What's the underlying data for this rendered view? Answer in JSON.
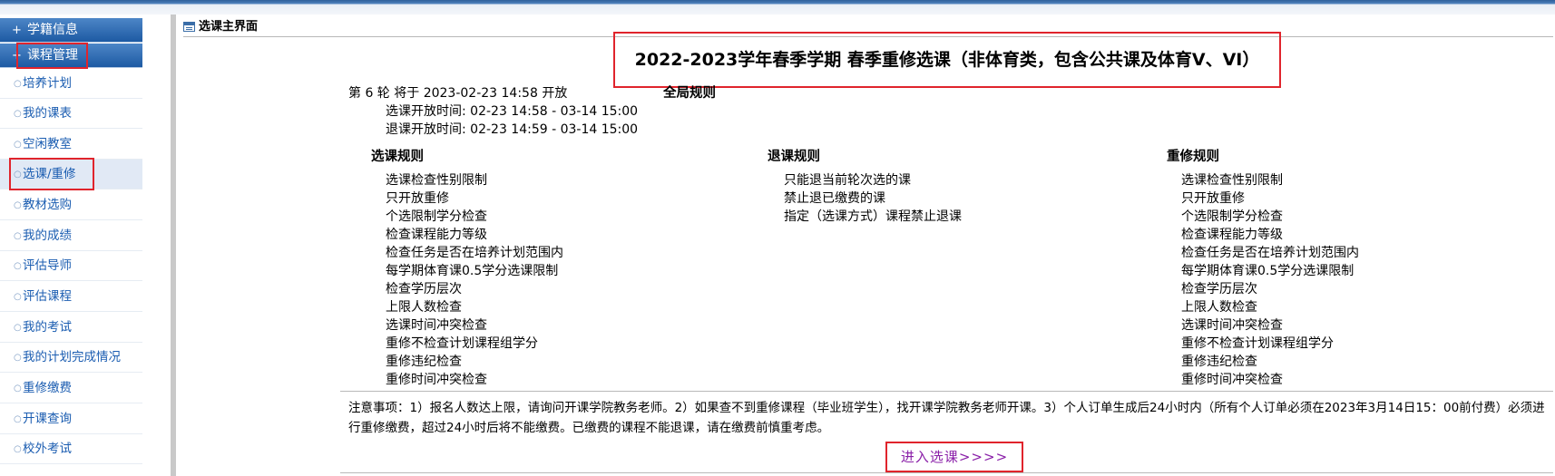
{
  "sidebar": {
    "sections": [
      {
        "label": "学籍信息"
      },
      {
        "label": "课程管理"
      }
    ],
    "items": [
      {
        "label": "培养计划"
      },
      {
        "label": "我的课表"
      },
      {
        "label": "空闲教室"
      },
      {
        "label": "选课/重修"
      },
      {
        "label": "教材选购"
      },
      {
        "label": "我的成绩"
      },
      {
        "label": "评估导师"
      },
      {
        "label": "评估课程"
      },
      {
        "label": "我的考试"
      },
      {
        "label": "我的计划完成情况"
      },
      {
        "label": "重修缴费"
      },
      {
        "label": "开课查询"
      },
      {
        "label": "校外考试"
      }
    ]
  },
  "main": {
    "panel_title": "选课主界面",
    "course_title": "2022-2023学年春季学期 春季重修选课（非体育类，包含公共课及体育V、VI）",
    "round_info": "第 6 轮 将于 2023-02-23 14:58 开放",
    "select_time": "选课开放时间: 02-23 14:58 - 03-14 15:00",
    "drop_time": "退课开放时间: 02-23 14:59 - 03-14 15:00",
    "global_rules_title": "全局规则",
    "select_rules": {
      "title": "选课规则",
      "items": [
        "选课检查性别限制",
        "只开放重修",
        "个选限制学分检查",
        "检查课程能力等级",
        "检查任务是否在培养计划范围内",
        "每学期体育课0.5学分选课限制",
        "检查学历层次",
        "上限人数检查",
        "选课时间冲突检查",
        "重修不检查计划课程组学分",
        "重修违纪检查",
        "重修时间冲突检查"
      ]
    },
    "drop_rules": {
      "title": "退课规则",
      "items": [
        "只能退当前轮次选的课",
        "禁止退已缴费的课",
        "指定（选课方式）课程禁止退课"
      ]
    },
    "retake_rules": {
      "title": "重修规则",
      "items": [
        "选课检查性别限制",
        "只开放重修",
        "个选限制学分检查",
        "检查课程能力等级",
        "检查任务是否在培养计划范围内",
        "每学期体育课0.5学分选课限制",
        "检查学历层次",
        "上限人数检查",
        "选课时间冲突检查",
        "重修不检查计划课程组学分",
        "重修违纪检查",
        "重修时间冲突检查"
      ]
    },
    "notice": "注意事项：1）报名人数达上限，请询问开课学院教务老师。2）如果查不到重修课程（毕业班学生），找开课学院教务老师开课。3）个人订单生成后24小时内（所有个人订单必须在2023年3月14日15：00前付费）必须进行重修缴费，超过24小时后将不能缴费。已缴费的课程不能退课，请在缴费前慎重考虑。",
    "enter_label": "进入选课>>>>"
  },
  "colors": {
    "highlight": "#e0242c",
    "link": "#1b5db1",
    "enter_link": "#8a1fa8"
  }
}
